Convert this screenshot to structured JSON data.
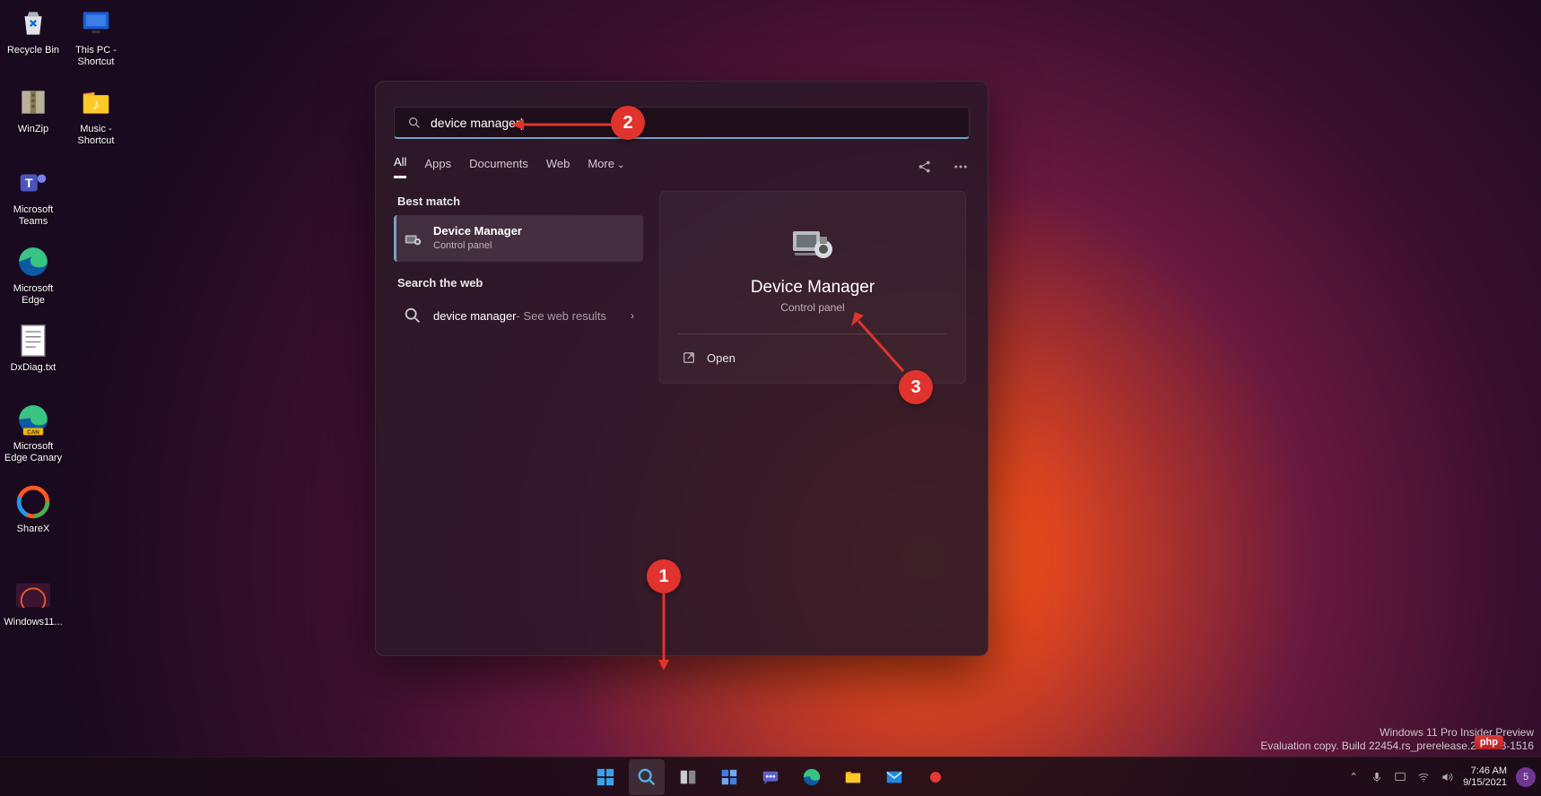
{
  "desktop_icons": [
    {
      "label": "Recycle Bin"
    },
    {
      "label": "This PC - Shortcut"
    },
    {
      "label": "WinZip"
    },
    {
      "label": "Music - Shortcut"
    },
    {
      "label": "Microsoft Teams"
    },
    {
      "label": "Microsoft Edge"
    },
    {
      "label": "DxDiag.txt"
    },
    {
      "label": "Microsoft Edge Canary"
    },
    {
      "label": "ShareX"
    },
    {
      "label": "Windows11..."
    }
  ],
  "search": {
    "query": "device manager",
    "tabs": [
      "All",
      "Apps",
      "Documents",
      "Web",
      "More"
    ],
    "active_tab": "All",
    "best_match_header": "Best match",
    "best_match": {
      "title": "Device Manager",
      "subtitle": "Control panel"
    },
    "web_header": "Search the web",
    "web_result": {
      "term": "device manager",
      "hint": " - See web results"
    },
    "detail": {
      "title": "Device Manager",
      "subtitle": "Control panel",
      "open": "Open"
    }
  },
  "annotations": {
    "step1": "1",
    "step2": "2",
    "step3": "3"
  },
  "watermark": {
    "line1": "Windows 11 Pro Insider Preview",
    "line2": "Evaluation copy. Build 22454.rs_prerelease.210903-1516",
    "badge": "php"
  },
  "tray": {
    "time": "7:46 AM",
    "date": "9/15/2021"
  }
}
